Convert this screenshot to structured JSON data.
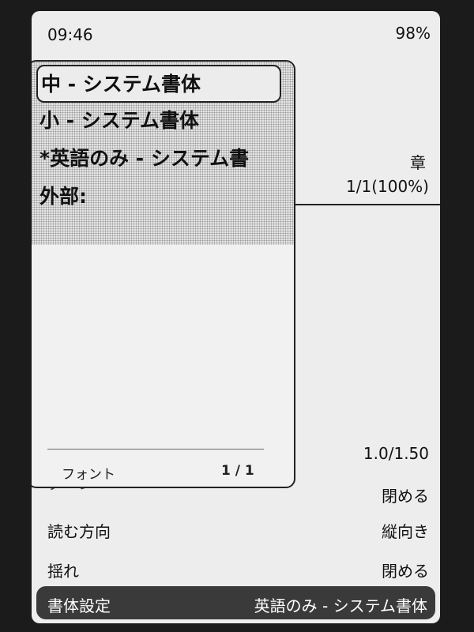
{
  "status_bar": {
    "time": "09:46",
    "battery": "98%"
  },
  "reader": {
    "chapter_label": "章",
    "progress": "1/1(100%)"
  },
  "settings": {
    "ratio_value": "1.0/1.50",
    "rows": [
      {
        "label": "ターン",
        "value": "閉める"
      },
      {
        "label": "読む方向",
        "value": "縦向き"
      },
      {
        "label": "揺れ",
        "value": "閉める"
      },
      {
        "label": "書体設定",
        "value": "英語のみ - システム書体"
      }
    ]
  },
  "font_popup": {
    "options": [
      "中 - システム書体",
      "小 - システム書体",
      "*英語のみ - システム書",
      "外部:"
    ],
    "title": "フォント",
    "page": "1 / 1"
  }
}
